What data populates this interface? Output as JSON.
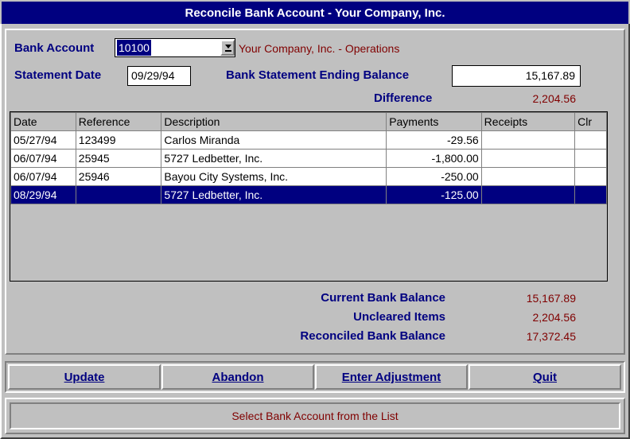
{
  "window": {
    "title": "Reconcile Bank Account - Your Company, Inc."
  },
  "header": {
    "bank_account_label": "Bank Account",
    "bank_account_value": "10100",
    "bank_account_name": "Your Company, Inc. - Operations",
    "statement_date_label": "Statement Date",
    "statement_date_value": "09/29/94",
    "ending_balance_label": "Bank Statement Ending Balance",
    "ending_balance_value": "15,167.89",
    "difference_label": "Difference",
    "difference_value": "2,204.56"
  },
  "table": {
    "columns": [
      "Date",
      "Reference",
      "Description",
      "Payments",
      "Receipts",
      "Clr"
    ],
    "rows": [
      {
        "date": "05/27/94",
        "reference": "123499",
        "description": "Carlos Miranda",
        "payments": "-29.56",
        "receipts": "",
        "clr": ""
      },
      {
        "date": "06/07/94",
        "reference": "25945",
        "description": "5727 Ledbetter, Inc.",
        "payments": "-1,800.00",
        "receipts": "",
        "clr": ""
      },
      {
        "date": "06/07/94",
        "reference": "25946",
        "description": "Bayou City Systems, Inc.",
        "payments": "-250.00",
        "receipts": "",
        "clr": ""
      },
      {
        "date": "08/29/94",
        "reference": "",
        "description": "5727 Ledbetter, Inc.",
        "payments": "-125.00",
        "receipts": "",
        "clr": "",
        "selected": true
      }
    ]
  },
  "summary": {
    "current_label": "Current Bank Balance",
    "current_value": "15,167.89",
    "uncleared_label": "Uncleared Items",
    "uncleared_value": "2,204.56",
    "reconciled_label": "Reconciled Bank Balance",
    "reconciled_value": "17,372.45"
  },
  "buttons": {
    "update": "Update",
    "abandon": "Abandon",
    "enter_adjustment": "Enter Adjustment",
    "quit": "Quit"
  },
  "status": {
    "message": "Select Bank Account from the List"
  },
  "icons": {
    "dropdown": "dropdown-arrow-icon"
  },
  "colors": {
    "title_bg": "#000080",
    "label": "#000080",
    "value": "#800000",
    "face": "#c0c0c0"
  }
}
